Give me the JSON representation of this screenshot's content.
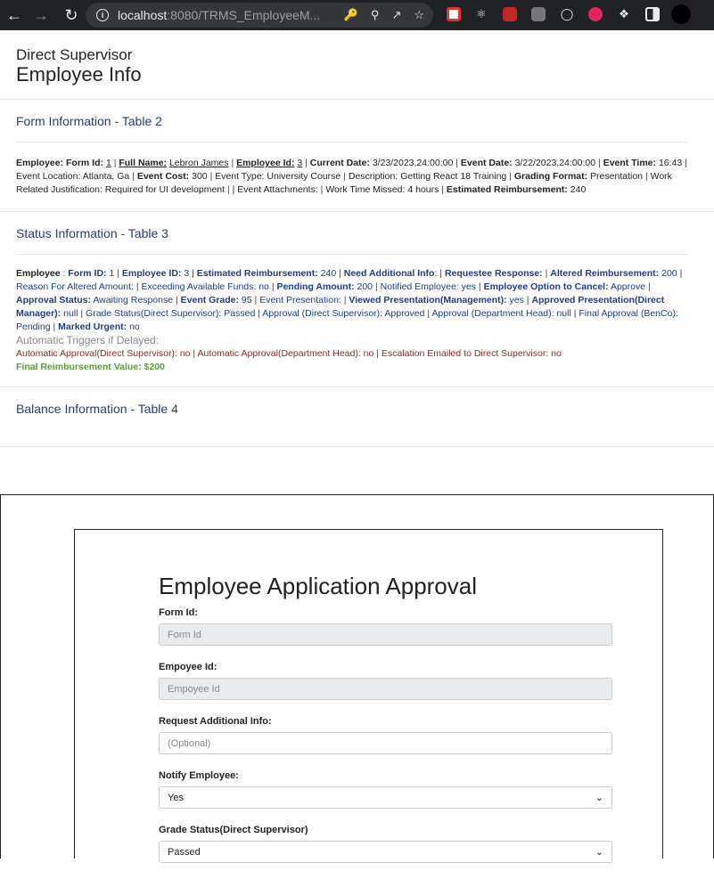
{
  "browser": {
    "url_host": "localhost",
    "url_rest": ":8080/TRMS_EmployeeM..."
  },
  "header": {
    "role": "Direct Supervisor",
    "title": "Employee Info"
  },
  "table2": {
    "title": "Form Information - Table 2",
    "employee_label": "Employee: Form Id:",
    "form_id": "1",
    "full_name_label": "Full Name:",
    "full_name": "Lebron James",
    "employee_id_label": "Employee Id:",
    "employee_id": "3",
    "current_date_label": "Current Date:",
    "current_date": "3/23/2023,24:00:00",
    "event_date_label": "Event Date:",
    "event_date": "3/22/2023,24:00:00",
    "event_time_label": "Event Time:",
    "event_time": "16:43",
    "event_location": "Event Location: Atlanta, Ga",
    "event_cost_label": "Event Cost:",
    "event_cost": "300",
    "event_type": "Event Type: University Course",
    "description": "Description: Getting React 18 Training",
    "grading_format_label": "Grading Format:",
    "grading_format": "Presentation",
    "justification": "Work Related Justification: Required for UI development",
    "attachments": "| Event Attachments:",
    "time_missed": "Work Time Missed: 4 hours",
    "estimated_label": "Estimated Reimbursement:",
    "estimated": "240"
  },
  "table3": {
    "title": "Status Information - Table 3",
    "employee_label": "Employee",
    "form_id_label": "Form ID:",
    "form_id": "1",
    "employee_id_label": "Employee ID:",
    "employee_id": "3",
    "est_label": "Estimated Reimbursement:",
    "est": "240",
    "need_info_label": "Need Additional Info",
    "requestee_label": "Requestee Response:",
    "altered_label": "Altered Reimbursement:",
    "altered": "200",
    "reason": "Reason For Altered Amount:",
    "exceeding": "Exceeding Available Funds: no",
    "pending_label": "Pending Amount:",
    "pending": "200",
    "notified": "Notified Employee: yes",
    "cancel_label": "Employee Option to Cancel:",
    "cancel": "Approve",
    "approval_status_label": "Approval Status:",
    "approval_status": "Awaiting Response",
    "grade_label": "Event Grade:",
    "grade": "95",
    "event_presentation": "Event Presentation:",
    "viewed_label": "Viewed Presentation(Management):",
    "viewed": "yes",
    "approved_pres_label": "Approved Presentation(Direct Manager):",
    "approved_pres": "null",
    "grade_status": "Grade Status(Direct Supervisor): Passed",
    "approval_ds": "Approval (Direct Supervisor): Approved",
    "approval_dh": "Approval (Department Head): null",
    "final_approval": "Final Approval (BenCo): Pending",
    "urgent_label": "Marked Urgent:",
    "urgent": "no",
    "triggers_title": "Automatic Triggers if Delayed:",
    "auto_ds": "Automatic Approval(Direct Supervisor): no",
    "auto_dh": "Automatic Approval(Department Head): no",
    "escalation": "Escalation Emailed to Direct Supervisor: no",
    "final_value": "Final Reimbursement Value: $200"
  },
  "table4": {
    "title": "Balance Information - Table 4"
  },
  "form": {
    "title": "Employee Application Approval",
    "form_id_label": "Form Id:",
    "form_id_placeholder": "Form Id",
    "employee_id_label": "Empoyee Id:",
    "employee_id_placeholder": "Empoyee Id",
    "additional_label": "Request Additional Info:",
    "additional_placeholder": "(Optional)",
    "notify_label": "Notify Employee:",
    "notify_value": "Yes",
    "grade_status_label": "Grade Status(Direct Supervisor)",
    "grade_status_value": "Passed"
  }
}
